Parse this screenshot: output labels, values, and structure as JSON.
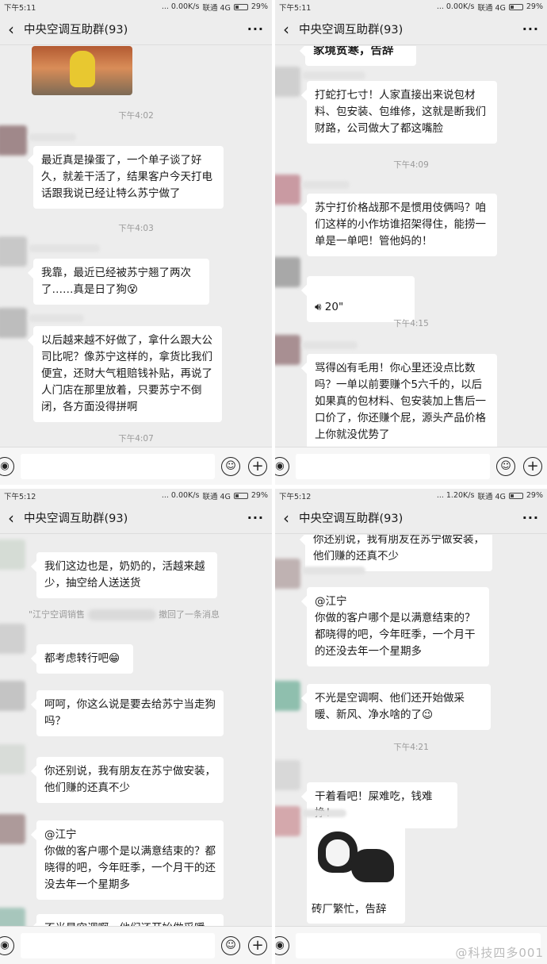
{
  "panels": [
    {
      "status": {
        "time": "下午5:11",
        "net": "... 0.00K/s",
        "carrier": "联通 4G",
        "battery": "29%"
      },
      "title": "中央空调互助群(93)",
      "messages": [
        {
          "type": "time",
          "text": "下午4:02"
        },
        {
          "type": "text",
          "text": "最近真是操蛋了，一个单子谈了好久，就差干活了，结果客户今天打电话跟我说已经让特么苏宁做了"
        },
        {
          "type": "time",
          "text": "下午4:03"
        },
        {
          "type": "text",
          "text": "我靠，最近已经被苏宁翘了两次了……真是日了狗😵"
        },
        {
          "type": "text",
          "text": "以后越来越不好做了，拿什么跟大公司比呢？像苏宁这样的，拿货比我们便宜，还财大气粗赔钱补贴，再说了人门店在那里放着，只要苏宁不倒闭，各方面没得拼啊"
        },
        {
          "type": "time",
          "text": "下午4:07"
        }
      ]
    },
    {
      "status": {
        "time": "下午5:11",
        "net": "... 0.00K/s",
        "carrier": "联通 4G",
        "battery": "29%"
      },
      "title": "中央空调互助群(93)",
      "messages": [
        {
          "type": "text",
          "text": "家境贫寒，告辞"
        },
        {
          "type": "text",
          "text": "打蛇打七寸！人家直接出来说包材料、包安装、包维修，这就是断我们财路，公司做大了都这嘴脸"
        },
        {
          "type": "time",
          "text": "下午4:09"
        },
        {
          "type": "text",
          "text": "苏宁打价格战那不是惯用伎俩吗？咱们这样的小作坊谁招架得住，能捞一单是一单吧！管他妈的！"
        },
        {
          "type": "voice",
          "text": "20\""
        },
        {
          "type": "time",
          "text": "下午4:15"
        },
        {
          "type": "text",
          "text": "骂得凶有毛用！你心里还没点比数吗？一单以前要赚个5六千的，以后如果真的包材料、包安装加上售后一口价了，你还赚个屁，源头产品价格上你就没优势了"
        }
      ]
    },
    {
      "status": {
        "time": "下午5:12",
        "net": "... 0.00K/s",
        "carrier": "联通 4G",
        "battery": "29%"
      },
      "title": "中央空调互助群(93)",
      "messages": [
        {
          "type": "text",
          "text": "我们这边也是，奶奶的，活越来越少，抽空给人送送货"
        },
        {
          "type": "recall",
          "prefix": "\"江宁空调销售",
          "suffix": "撤回了一条消息"
        },
        {
          "type": "text",
          "text": "都考虑转行吧😁"
        },
        {
          "type": "text",
          "text": "呵呵，你这么说是要去给苏宁当走狗吗？"
        },
        {
          "type": "text",
          "text": "你还别说，我有朋友在苏宁做安装，他们赚的还真不少"
        },
        {
          "type": "text",
          "text": "@江宁\n你做的客户哪个是以满意结束的？都晓得的吧，今年旺季，一个月干的还没去年一个星期多"
        },
        {
          "type": "text",
          "text": "不光是空调啊、他们还开始做采暖、"
        }
      ]
    },
    {
      "status": {
        "time": "下午5:12",
        "net": "... 1.20K/s",
        "carrier": "联通 4G",
        "battery": "29%"
      },
      "title": "中央空调互助群(93)",
      "messages": [
        {
          "type": "text",
          "text": "你还别说，我有朋友在苏宁做安装，他们赚的还真不少"
        },
        {
          "type": "text",
          "text": "@江宁\n你做的客户哪个是以满意结束的？都晓得的吧，今年旺季，一个月干的还没去年一个星期多"
        },
        {
          "type": "text",
          "text": "不光是空调啊、他们还开始做采暖、新风、净水啥的了😉"
        },
        {
          "type": "time",
          "text": "下午4:21"
        },
        {
          "type": "text",
          "text": "干着看吧！屎难吃，钱难挣！"
        },
        {
          "type": "sticker",
          "text": "砖厂繁忙，告辞"
        }
      ],
      "watermark": "@科技四多001"
    }
  ],
  "icons": {
    "back": "back-arrow-icon",
    "more": "more-dots-icon",
    "voice": "voice-input-icon",
    "emoji": "emoji-icon",
    "plus": "plus-icon"
  }
}
